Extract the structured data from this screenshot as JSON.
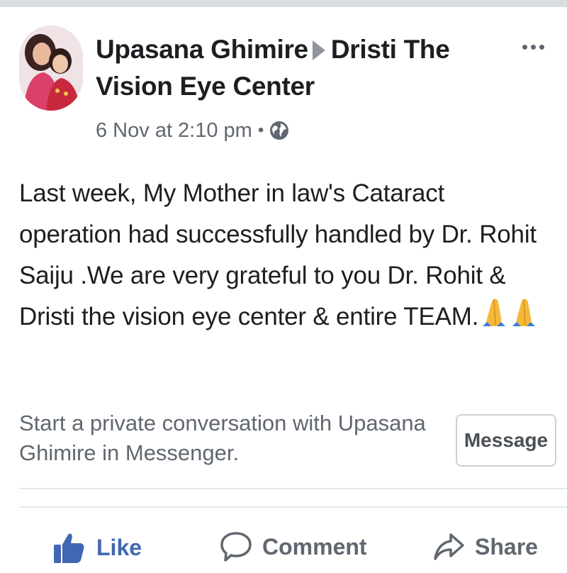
{
  "post": {
    "author": "Upasana Ghimire",
    "target_page": "Dristi The Vision Eye Center",
    "timestamp": "6 Nov at 2:10 pm",
    "separator": "•",
    "audience_icon": "globe-icon",
    "body_text": "Last week, My Mother in law's Cataract operation had successfully handled by Dr. Rohit Saiju .We are very grateful to you Dr. Rohit & Dristi the vision eye center & entire TEAM.",
    "body_emoji": "folded-hands-icon x2"
  },
  "messenger_prompt": {
    "text": "Start a private conversation with Upasana Ghimire in Messenger.",
    "button_label": "Message"
  },
  "actions": {
    "like_label": "Like",
    "comment_label": "Comment",
    "share_label": "Share"
  },
  "colors": {
    "like_blue": "#4267b2",
    "secondary_text": "#606770",
    "primary_text": "#1c1e21",
    "divider": "#e4e6eb"
  }
}
